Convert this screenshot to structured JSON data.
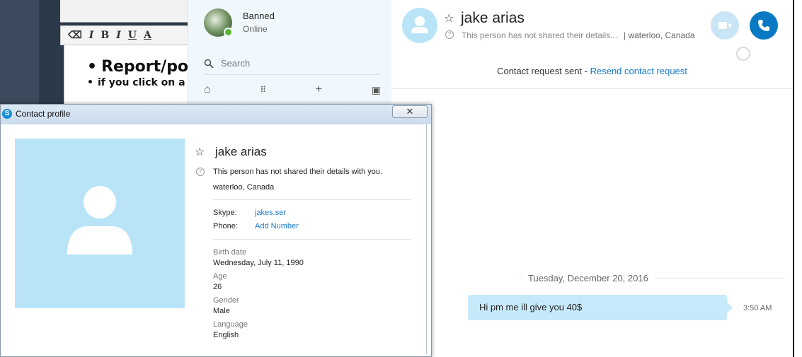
{
  "editor": {
    "heading": "Report/po",
    "line": "if you click on a",
    "toolbar": [
      "I",
      "B",
      "I",
      "U",
      "A"
    ]
  },
  "sidebar": {
    "user_name": "Banned",
    "user_status": "Online",
    "search_placeholder": "Search"
  },
  "chat": {
    "contact_name": "jake arias",
    "subtitle": "This person has not shared their details...",
    "location": "| waterloo, Canada",
    "request_text": "Contact request sent - ",
    "request_link": "Resend contact request",
    "date": "Tuesday, December 20, 2016",
    "message": "Hi pm me ill give you 40$",
    "message_time": "3:50 AM",
    "colors": {
      "accent": "#0a78c2",
      "bubble": "#c7eafb",
      "avatar": "#b9e4f7"
    }
  },
  "profile": {
    "window_title": "Contact profile",
    "name": "jake arias",
    "details_note": "This person has not shared their details with you.",
    "location": "waterloo, Canada",
    "skype_label": "Skype:",
    "skype_value": "jakes.ser",
    "phone_label": "Phone:",
    "phone_value": "Add Number",
    "birth_label": "Birth date",
    "birth_value": "Wednesday, July 11, 1990",
    "age_label": "Age",
    "age_value": "26",
    "gender_label": "Gender",
    "gender_value": "Male",
    "language_label": "Language",
    "language_value": "English"
  }
}
